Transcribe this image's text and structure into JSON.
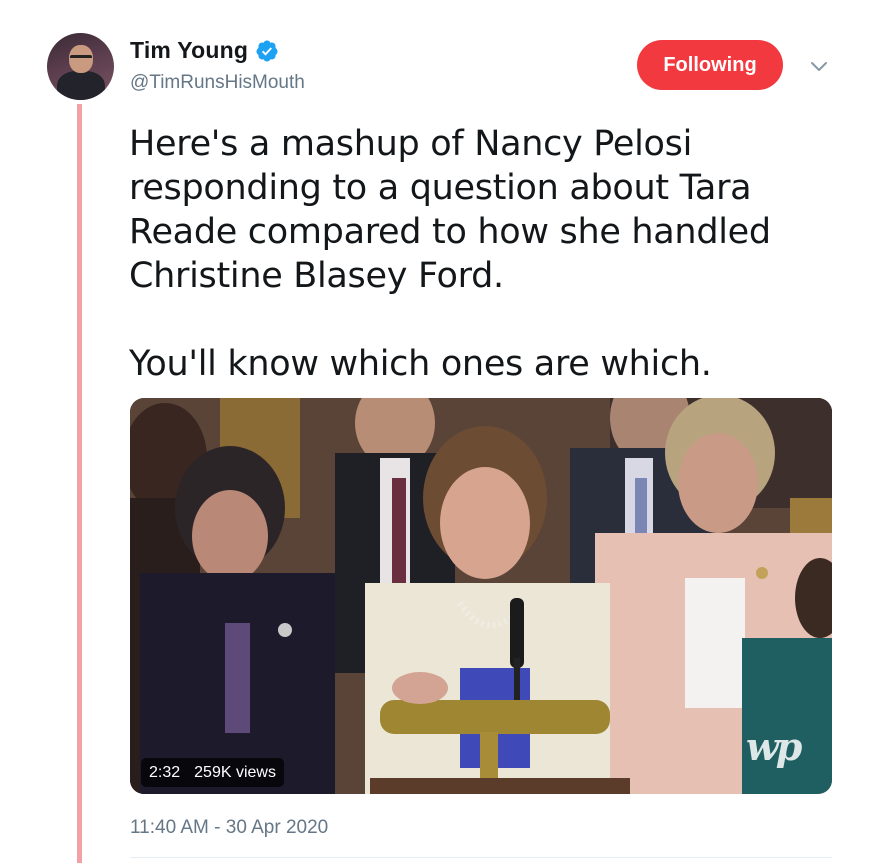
{
  "tweet": {
    "display_name": "Tim Young",
    "handle": "@TimRunsHisMouth",
    "follow_button_label": "Following",
    "text": "Here's a mashup of Nancy Pelosi responding to a question about Tara Reade compared to how she handled Christine Blasey Ford.\n\nYou'll know which ones are which.",
    "timestamp": "11:40 AM - 30 Apr 2020"
  },
  "video": {
    "duration": "2:32",
    "views": "259K views",
    "watermark": "wp"
  },
  "icons": {
    "verified": "verified-badge-icon",
    "caret": "chevron-down-icon"
  },
  "colors": {
    "follow_button": "#f2393f",
    "thread_line": "#f3a1a6",
    "secondary_text": "#657786",
    "verified": "#1da1f2"
  }
}
